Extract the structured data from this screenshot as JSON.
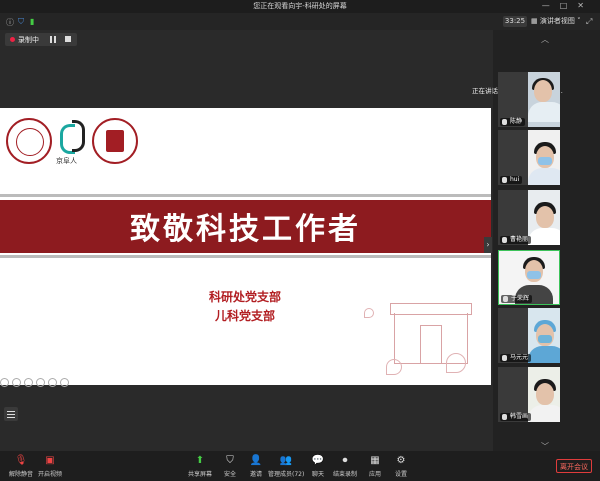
{
  "window": {
    "title": "您正在观看向宇-科研处的屏幕"
  },
  "topbar": {
    "timer": "33:25",
    "view_label": "演讲者视图"
  },
  "recording": {
    "label": "录制中"
  },
  "slide": {
    "logo_text": "京阜人",
    "title": "致敬科技工作者",
    "dept1": "科研处党支部",
    "dept2": "儿科党支部"
  },
  "speaking": {
    "label": "正在讲话: 韩颖-北京大学第一..."
  },
  "participants": [
    {
      "name": "陈静"
    },
    {
      "name": "hui"
    },
    {
      "name": "曹艳丽"
    },
    {
      "name": "于荣辉"
    },
    {
      "name": "马元元"
    },
    {
      "name": "韩雪画"
    }
  ],
  "bottombar": {
    "mute": "解除静音",
    "video": "开启视频",
    "share": "共享屏幕",
    "security": "安全",
    "invite": "邀请",
    "participants": "管理成员(72)",
    "chat": "聊天",
    "record": "结束录制",
    "apps": "应用",
    "settings": "设置",
    "leave": "离开会议"
  },
  "colors": {
    "slide_red": "#8d1b1f",
    "dept_red": "#b21e22",
    "leave_red": "#e03c3c"
  }
}
